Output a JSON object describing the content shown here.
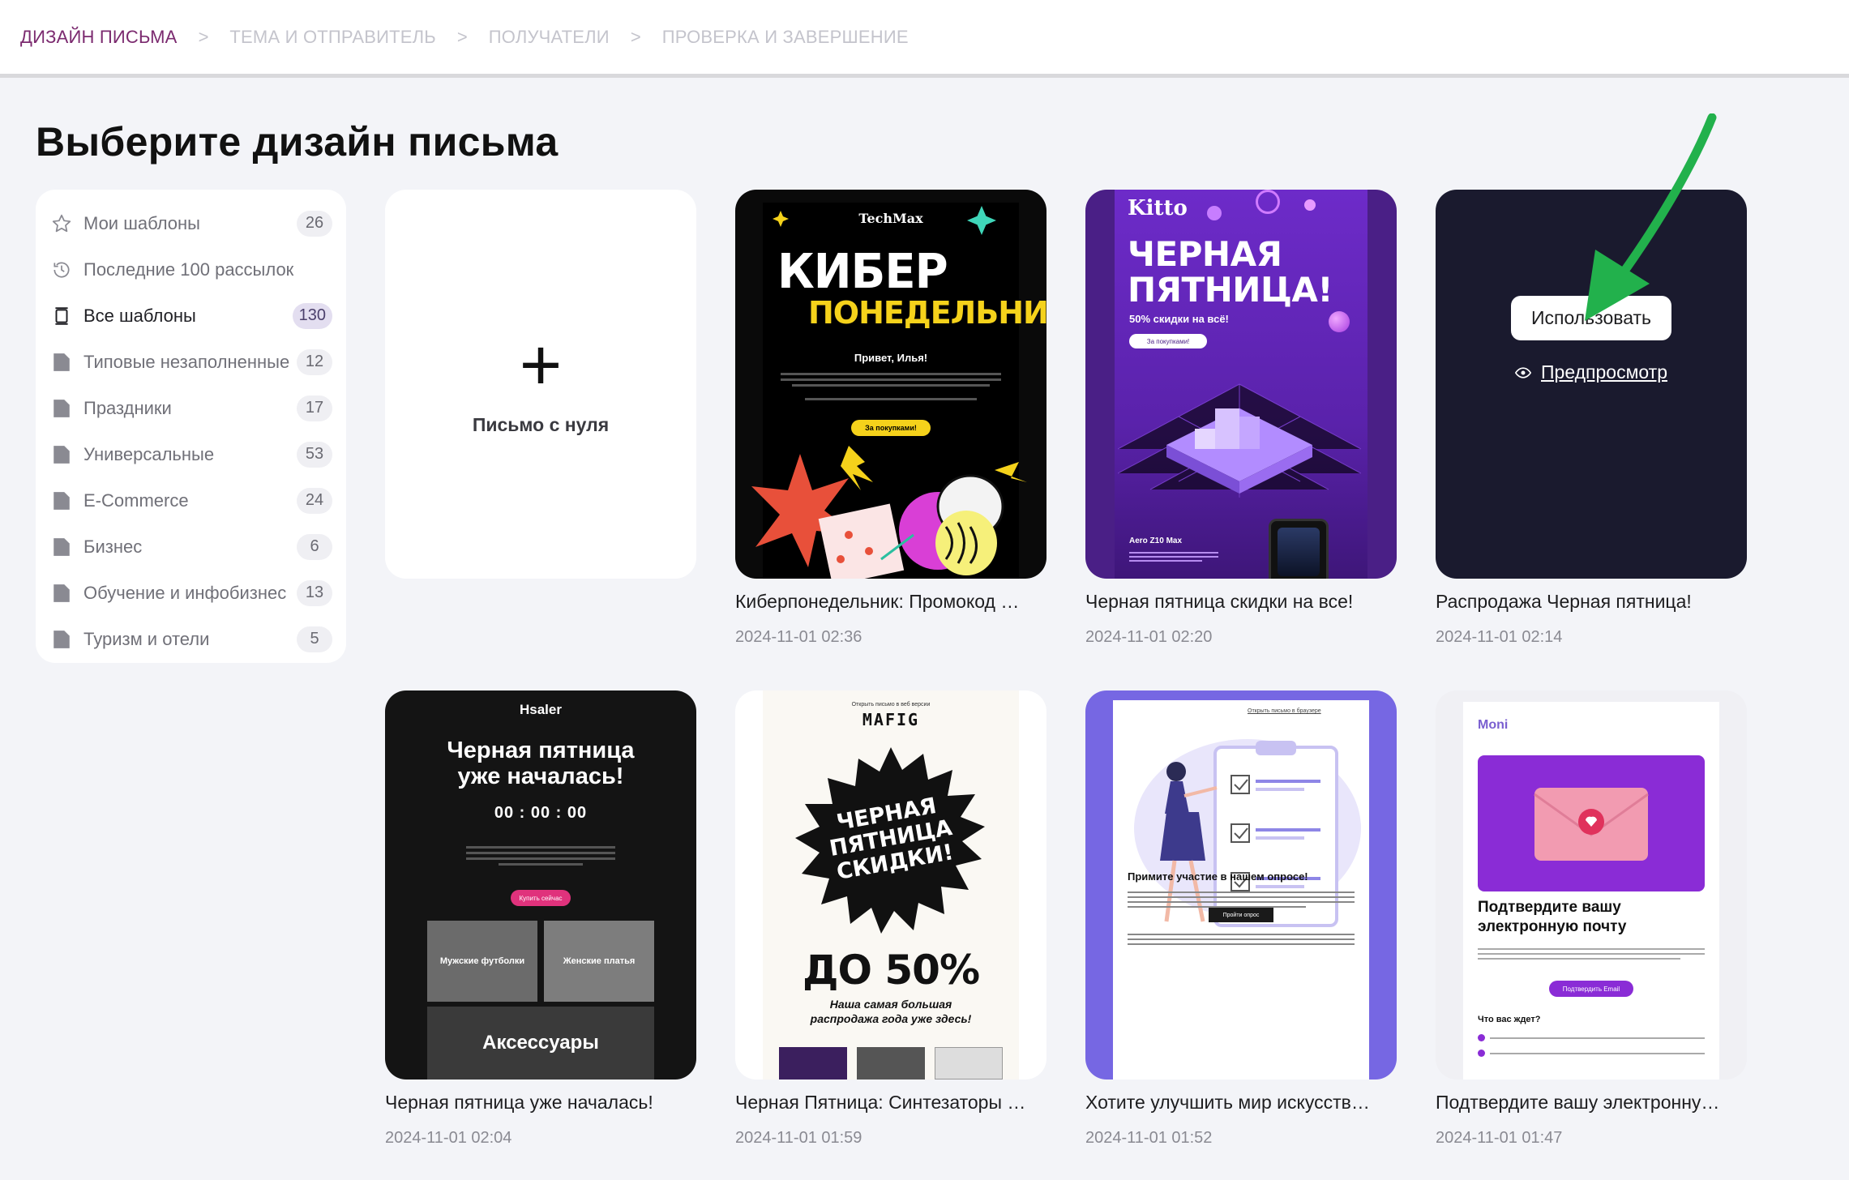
{
  "stepper": {
    "steps": [
      {
        "label": "ДИЗАЙН ПИСЬМА",
        "active": true
      },
      {
        "label": "ТЕМА И ОТПРАВИТЕЛЬ",
        "active": false
      },
      {
        "label": "ПОЛУЧАТЕЛИ",
        "active": false
      },
      {
        "label": "ПРОВЕРКА И ЗАВЕРШЕНИЕ",
        "active": false
      }
    ],
    "separator": ">"
  },
  "page": {
    "title": "Выберите дизайн письма"
  },
  "sidebar": {
    "items": [
      {
        "label": "Мои шаблоны",
        "count": "26",
        "icon": "star-icon"
      },
      {
        "label": "Последние 100 рассылок",
        "count": "",
        "icon": "history-icon"
      },
      {
        "label": "Все шаблоны",
        "count": "130",
        "icon": "stack-icon",
        "active": true
      },
      {
        "label": "Типовые незаполненные",
        "count": "12",
        "icon": "folder-icon"
      },
      {
        "label": "Праздники",
        "count": "17",
        "icon": "folder-icon"
      },
      {
        "label": "Универсальные",
        "count": "53",
        "icon": "folder-icon"
      },
      {
        "label": "E-Commerce",
        "count": "24",
        "icon": "folder-icon"
      },
      {
        "label": "Бизнес",
        "count": "6",
        "icon": "folder-icon"
      },
      {
        "label": "Обучение и инфобизнес",
        "count": "13",
        "icon": "folder-icon"
      },
      {
        "label": "Туризм и отели",
        "count": "5",
        "icon": "folder-icon"
      }
    ]
  },
  "blank_card": {
    "plus": "+",
    "label": "Письмо с нуля"
  },
  "hover_actions": {
    "use": "Использовать",
    "preview": "Предпросмотр"
  },
  "cards": [
    {
      "title": "Киберпонедельник: Промокод …",
      "date": "2024-11-01 02:36",
      "thumb": {
        "brand": "TechMax",
        "line1": "КИБЕР",
        "line2": "ПОНЕДЕЛЬНИК",
        "greeting": "Привет, Илья!",
        "button": "За покупками!"
      }
    },
    {
      "title": "Черная пятница скидки на все!",
      "date": "2024-11-01 02:20",
      "thumb": {
        "brand": "Kitto",
        "line1": "ЧЕРНАЯ",
        "line2": "ПЯТНИЦА!",
        "sub": "50% скидки на всё!",
        "button": "За покупками!",
        "product": "Aero Z10 Max"
      }
    },
    {
      "title": "Распродажа Черная пятница!",
      "date": "2024-11-01 02:14"
    },
    {
      "title": "Черная пятница уже началась!",
      "date": "2024-11-01 02:04",
      "thumb": {
        "brand": "Hsaler",
        "line1": "Черная пятница",
        "line2": "уже началась!",
        "timer": "00 : 00 : 00",
        "button": "Купить сейчас",
        "cat1": "Мужские футболки",
        "cat2": "Женские платья",
        "cat3": "Аксессуары"
      }
    },
    {
      "title": "Черная Пятница: Синтезаторы …",
      "date": "2024-11-01 01:59",
      "thumb": {
        "top": "Открыть письмо в веб версии",
        "brand": "MAFIG",
        "burst": "ЧЕРНАЯ ПЯТНИЦА СКИДКИ!",
        "big": "ДО 50%",
        "sub": "Наша самая большая распродажа года уже здесь!"
      }
    },
    {
      "title": "Хотите улучшить мир искусств…",
      "date": "2024-11-01 01:52",
      "thumb": {
        "top": "Открыть письмо в браузере",
        "heading": "Примите участие в нашем опросе!",
        "button": "Пройти опрос"
      }
    },
    {
      "title": "Подтвердите вашу электронну…",
      "date": "2024-11-01 01:47",
      "thumb": {
        "brand": "Moni",
        "heading": "Подтвердите вашу электронную почту",
        "button": "Подтвердить Email",
        "sub": "Что вас ждет?"
      }
    }
  ],
  "colors": {
    "accent": "#7b2a6f",
    "inactive_step": "#c4c4cc",
    "arrow": "#22b14c"
  }
}
